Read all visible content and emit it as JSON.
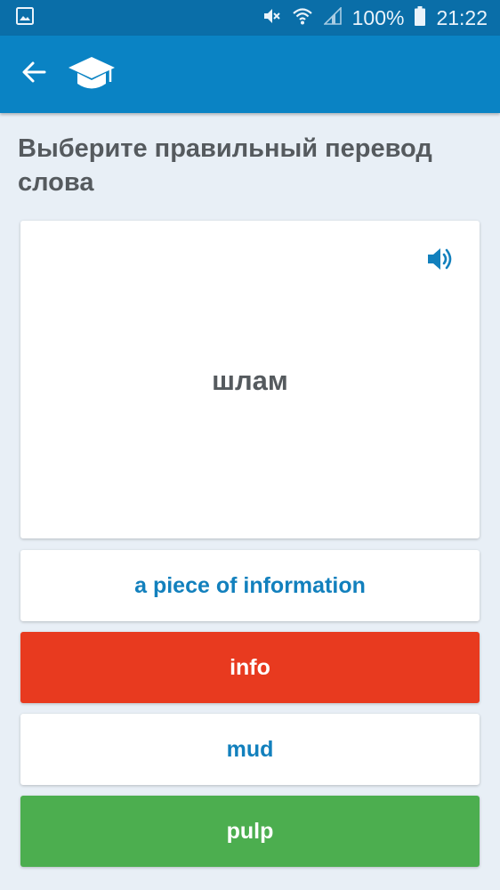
{
  "status_bar": {
    "battery_text": "100%",
    "time": "21:22",
    "icons": [
      "gallery-icon",
      "mute-icon",
      "wifi-icon",
      "signal-icon",
      "battery-icon"
    ]
  },
  "app_bar": {
    "icons": [
      "back-arrow-icon",
      "graduation-cap-icon"
    ]
  },
  "quiz": {
    "prompt": "Выберите правильный перевод слова",
    "word": "шлам",
    "speaker_icon": "speaker-icon",
    "options": [
      {
        "label": "a piece of information",
        "state": "normal"
      },
      {
        "label": "info",
        "state": "wrong"
      },
      {
        "label": "mud",
        "state": "normal"
      },
      {
        "label": "pulp",
        "state": "correct"
      }
    ]
  },
  "colors": {
    "status_bar": "#0a6ea8",
    "app_bar": "#0a83c4",
    "background": "#e8eff6",
    "option_text": "#1280bd",
    "wrong": "#e83a1f",
    "correct": "#4cae4f"
  }
}
